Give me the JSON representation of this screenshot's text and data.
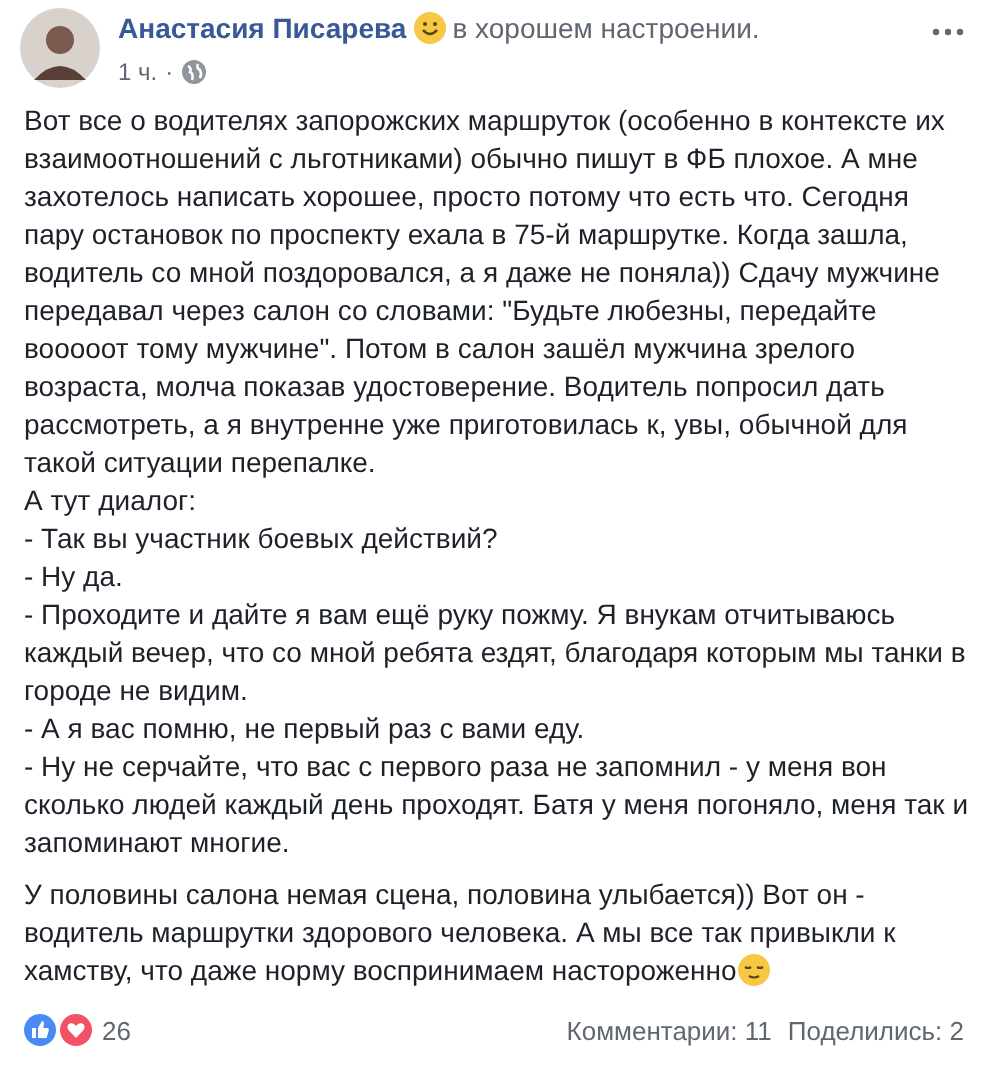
{
  "post": {
    "author": "Анастасия Писарева",
    "feeling": "в хорошем настроении.",
    "time": "1 ч.",
    "separator": "·",
    "paragraphs": [
      {
        "lines": [
          "Вот все о водителях запорожских маршруток (особенно в контексте их",
          "взаимоотношений с льготниками) обычно пишут в ФБ плохое. А мне",
          "захотелось написать хорошее, просто потому что есть что. Сегодня",
          "пару остановок по проспекту ехала в 75-й маршрутке. Когда зашла,",
          "водитель со мной поздоровался, а я даже не поняла)) Сдачу мужчине",
          "передавал через салон со словами: \"Будьте любезны, передайте",
          "вооооот тому мужчине\". Потом в салон зашёл мужчина зрелого",
          "возраста, молча показав удостоверение. Водитель попросил дать",
          "рассмотреть, а я внутренне уже приготовилась к, увы, обычной для",
          "такой ситуации перепалке.",
          "А тут диалог:",
          "- Так вы участник боевых действий?",
          "- Ну да.",
          "- Проходите и дайте я вам ещё руку пожму. Я внукам отчитываюсь",
          "каждый вечер, что со мной ребята ездят, благодаря которым мы танки в",
          "городе не видим.",
          "- А я вас помню, не первый раз с вами еду.",
          "- Ну не серчайте, что вас с первого раза не запомнил - у меня вон",
          "сколько людей каждый день проходят. Батя у меня погоняло, меня так и",
          "запоминают многие."
        ],
        "ends_with_emoji": false
      },
      {
        "lines": [
          "У половины салона немая сцена, половина улыбается)) Вот он -",
          "водитель маршрутки здорового человека. А мы все так привыкли к",
          "хамству, что даже норму воспринимаем настороженно"
        ],
        "ends_with_emoji": true
      }
    ],
    "reactions_count": "26",
    "comments": "Комментарии: 11",
    "shares": "Поделились: 2"
  }
}
